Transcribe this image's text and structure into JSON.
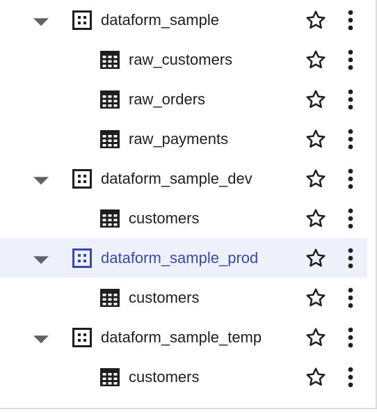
{
  "tree": {
    "datasets": [
      {
        "name": "dataform_sample",
        "selected": false,
        "tables": [
          "raw_customers",
          "raw_orders",
          "raw_payments"
        ]
      },
      {
        "name": "dataform_sample_dev",
        "selected": false,
        "tables": [
          "customers"
        ]
      },
      {
        "name": "dataform_sample_prod",
        "selected": true,
        "tables": [
          "customers"
        ]
      },
      {
        "name": "dataform_sample_temp",
        "selected": false,
        "tables": [
          "customers"
        ]
      }
    ]
  },
  "icons": {
    "expand": "caret-down-icon",
    "dataset": "dataset-icon",
    "table": "table-icon",
    "star": "star-outline-icon",
    "more": "more-vert-icon"
  },
  "colors": {
    "text": "#1f1f1f",
    "icon": "#1f1f1f",
    "caret": "#5f6368",
    "selected_text": "#3949ab",
    "selected_background": "#eef1fb"
  }
}
